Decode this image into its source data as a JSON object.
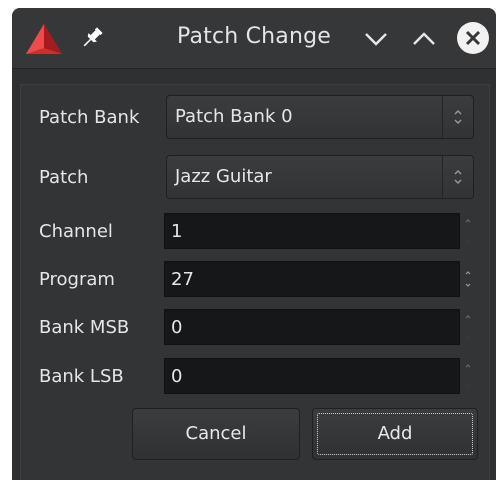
{
  "window": {
    "title": "Patch Change"
  },
  "form": {
    "patch_bank": {
      "label": "Patch Bank",
      "value": "Patch Bank 0"
    },
    "patch": {
      "label": "Patch",
      "value": "Jazz Guitar"
    },
    "channel": {
      "label": "Channel",
      "value": "1"
    },
    "program": {
      "label": "Program",
      "value": "27"
    },
    "bank_msb": {
      "label": "Bank MSB",
      "value": "0"
    },
    "bank_lsb": {
      "label": "Bank LSB",
      "value": "0"
    }
  },
  "buttons": {
    "cancel": "Cancel",
    "add": "Add"
  },
  "colors": {
    "app_icon": "#d5232a",
    "background": "#2e3032",
    "field": "#161718"
  }
}
